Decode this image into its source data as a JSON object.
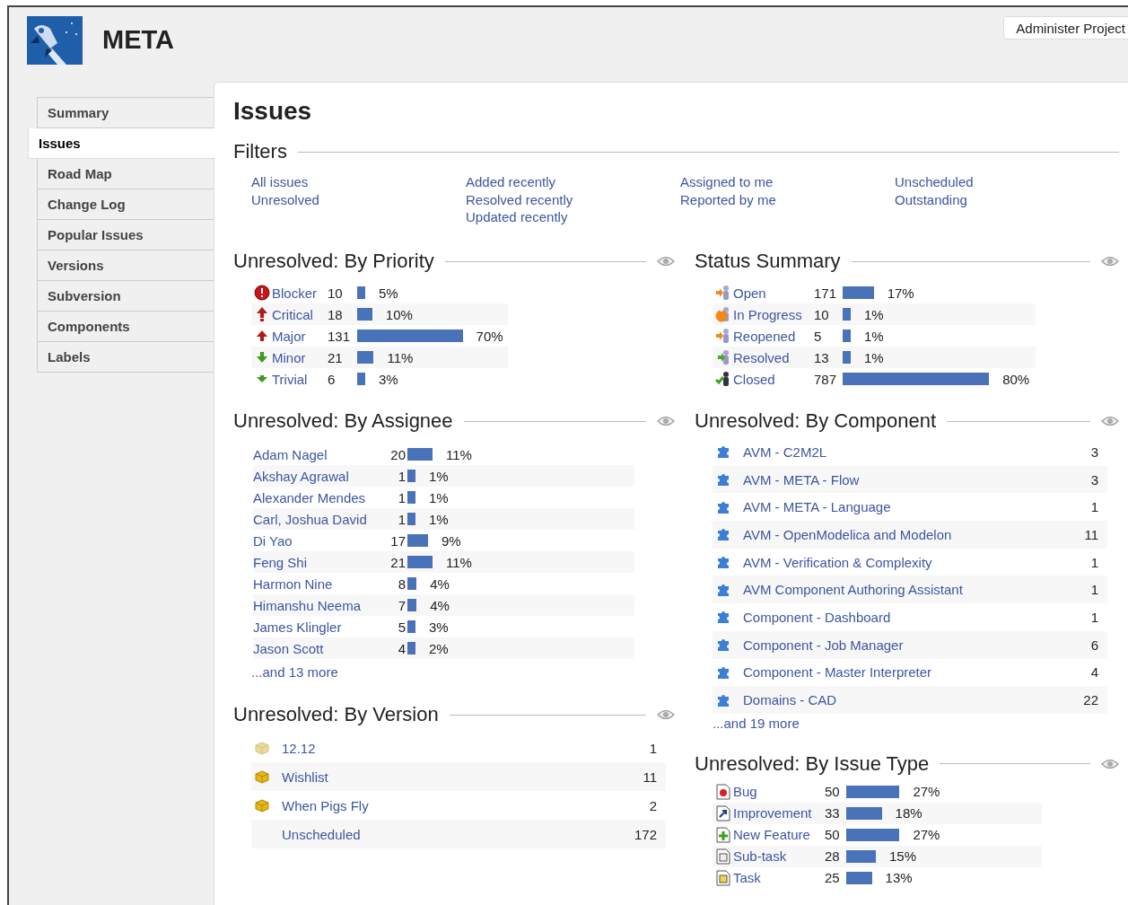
{
  "project": {
    "title": "META"
  },
  "header_button": "Administer Project",
  "sidebar": {
    "items": [
      {
        "label": "Summary",
        "selected": false
      },
      {
        "label": "Issues",
        "selected": true
      },
      {
        "label": "Road Map",
        "selected": false
      },
      {
        "label": "Change Log",
        "selected": false
      },
      {
        "label": "Popular Issues",
        "selected": false
      },
      {
        "label": "Versions",
        "selected": false
      },
      {
        "label": "Subversion",
        "selected": false
      },
      {
        "label": "Components",
        "selected": false
      },
      {
        "label": "Labels",
        "selected": false
      }
    ]
  },
  "page_title": "Issues",
  "filters": {
    "title": "Filters",
    "columns": [
      [
        "All issues",
        "Unresolved"
      ],
      [
        "Added recently",
        "Resolved recently",
        "Updated recently"
      ],
      [
        "Assigned to me",
        "Reported by me"
      ],
      [
        "Unscheduled",
        "Outstanding"
      ]
    ]
  },
  "by_priority": {
    "title": "Unresolved: By Priority",
    "rows": [
      {
        "kind": "blocker",
        "name": "Blocker",
        "count": "10",
        "percent": "5%"
      },
      {
        "kind": "critical",
        "name": "Critical",
        "count": "18",
        "percent": "10%"
      },
      {
        "kind": "major",
        "name": "Major",
        "count": "131",
        "percent": "70%"
      },
      {
        "kind": "minor",
        "name": "Minor",
        "count": "21",
        "percent": "11%"
      },
      {
        "kind": "trivial",
        "name": "Trivial",
        "count": "6",
        "percent": "3%"
      }
    ]
  },
  "status_summary": {
    "title": "Status Summary",
    "rows": [
      {
        "kind": "open",
        "name": "Open",
        "count": "171",
        "percent": "17%"
      },
      {
        "kind": "in-progress",
        "name": "In Progress",
        "count": "10",
        "percent": "1%"
      },
      {
        "kind": "reopened",
        "name": "Reopened",
        "count": "5",
        "percent": "1%"
      },
      {
        "kind": "resolved",
        "name": "Resolved",
        "count": "13",
        "percent": "1%"
      },
      {
        "kind": "closed",
        "name": "Closed",
        "count": "787",
        "percent": "80%"
      }
    ]
  },
  "by_assignee": {
    "title": "Unresolved: By Assignee",
    "rows": [
      {
        "name": "Adam Nagel",
        "count": "20",
        "percent": "11%"
      },
      {
        "name": "Akshay Agrawal",
        "count": "1",
        "percent": "1%"
      },
      {
        "name": "Alexander Mendes",
        "count": "1",
        "percent": "1%"
      },
      {
        "name": "Carl, Joshua David",
        "count": "1",
        "percent": "1%"
      },
      {
        "name": "Di Yao",
        "count": "17",
        "percent": "9%"
      },
      {
        "name": "Feng Shi",
        "count": "21",
        "percent": "11%"
      },
      {
        "name": "Harmon Nine",
        "count": "8",
        "percent": "4%"
      },
      {
        "name": "Himanshu Neema",
        "count": "7",
        "percent": "4%"
      },
      {
        "name": "James Klingler",
        "count": "5",
        "percent": "3%"
      },
      {
        "name": "Jason Scott",
        "count": "4",
        "percent": "2%"
      }
    ],
    "more": "...and 13 more"
  },
  "by_component": {
    "title": "Unresolved: By Component",
    "rows": [
      {
        "name": "AVM - C2M2L",
        "count": "3"
      },
      {
        "name": "AVM - META - Flow",
        "count": "3"
      },
      {
        "name": "AVM - META - Language",
        "count": "1"
      },
      {
        "name": "AVM - OpenModelica and Modelon",
        "count": "11"
      },
      {
        "name": "AVM - Verification & Complexity",
        "count": "1"
      },
      {
        "name": "AVM Component Authoring Assistant",
        "count": "1"
      },
      {
        "name": "Component - Dashboard",
        "count": "1"
      },
      {
        "name": "Component - Job Manager",
        "count": "6"
      },
      {
        "name": "Component - Master Interpreter",
        "count": "4"
      },
      {
        "name": "Domains - CAD",
        "count": "22"
      }
    ],
    "more": "...and 19 more"
  },
  "by_version": {
    "title": "Unresolved: By Version",
    "rows": [
      {
        "kind": "released",
        "name": "12.12",
        "count": "1"
      },
      {
        "kind": "unreleased",
        "name": "Wishlist",
        "count": "11"
      },
      {
        "kind": "unreleased",
        "name": "When Pigs Fly",
        "count": "2"
      },
      {
        "kind": "none",
        "name": "Unscheduled",
        "count": "172"
      }
    ]
  },
  "by_issue_type": {
    "title": "Unresolved: By Issue Type",
    "rows": [
      {
        "kind": "bug",
        "name": "Bug",
        "count": "50",
        "percent": "27%"
      },
      {
        "kind": "improvement",
        "name": "Improvement",
        "count": "33",
        "percent": "18%"
      },
      {
        "kind": "new-feature",
        "name": "New Feature",
        "count": "50",
        "percent": "27%"
      },
      {
        "kind": "sub-task",
        "name": "Sub-task",
        "count": "28",
        "percent": "15%"
      },
      {
        "kind": "task",
        "name": "Task",
        "count": "25",
        "percent": "13%"
      }
    ]
  }
}
